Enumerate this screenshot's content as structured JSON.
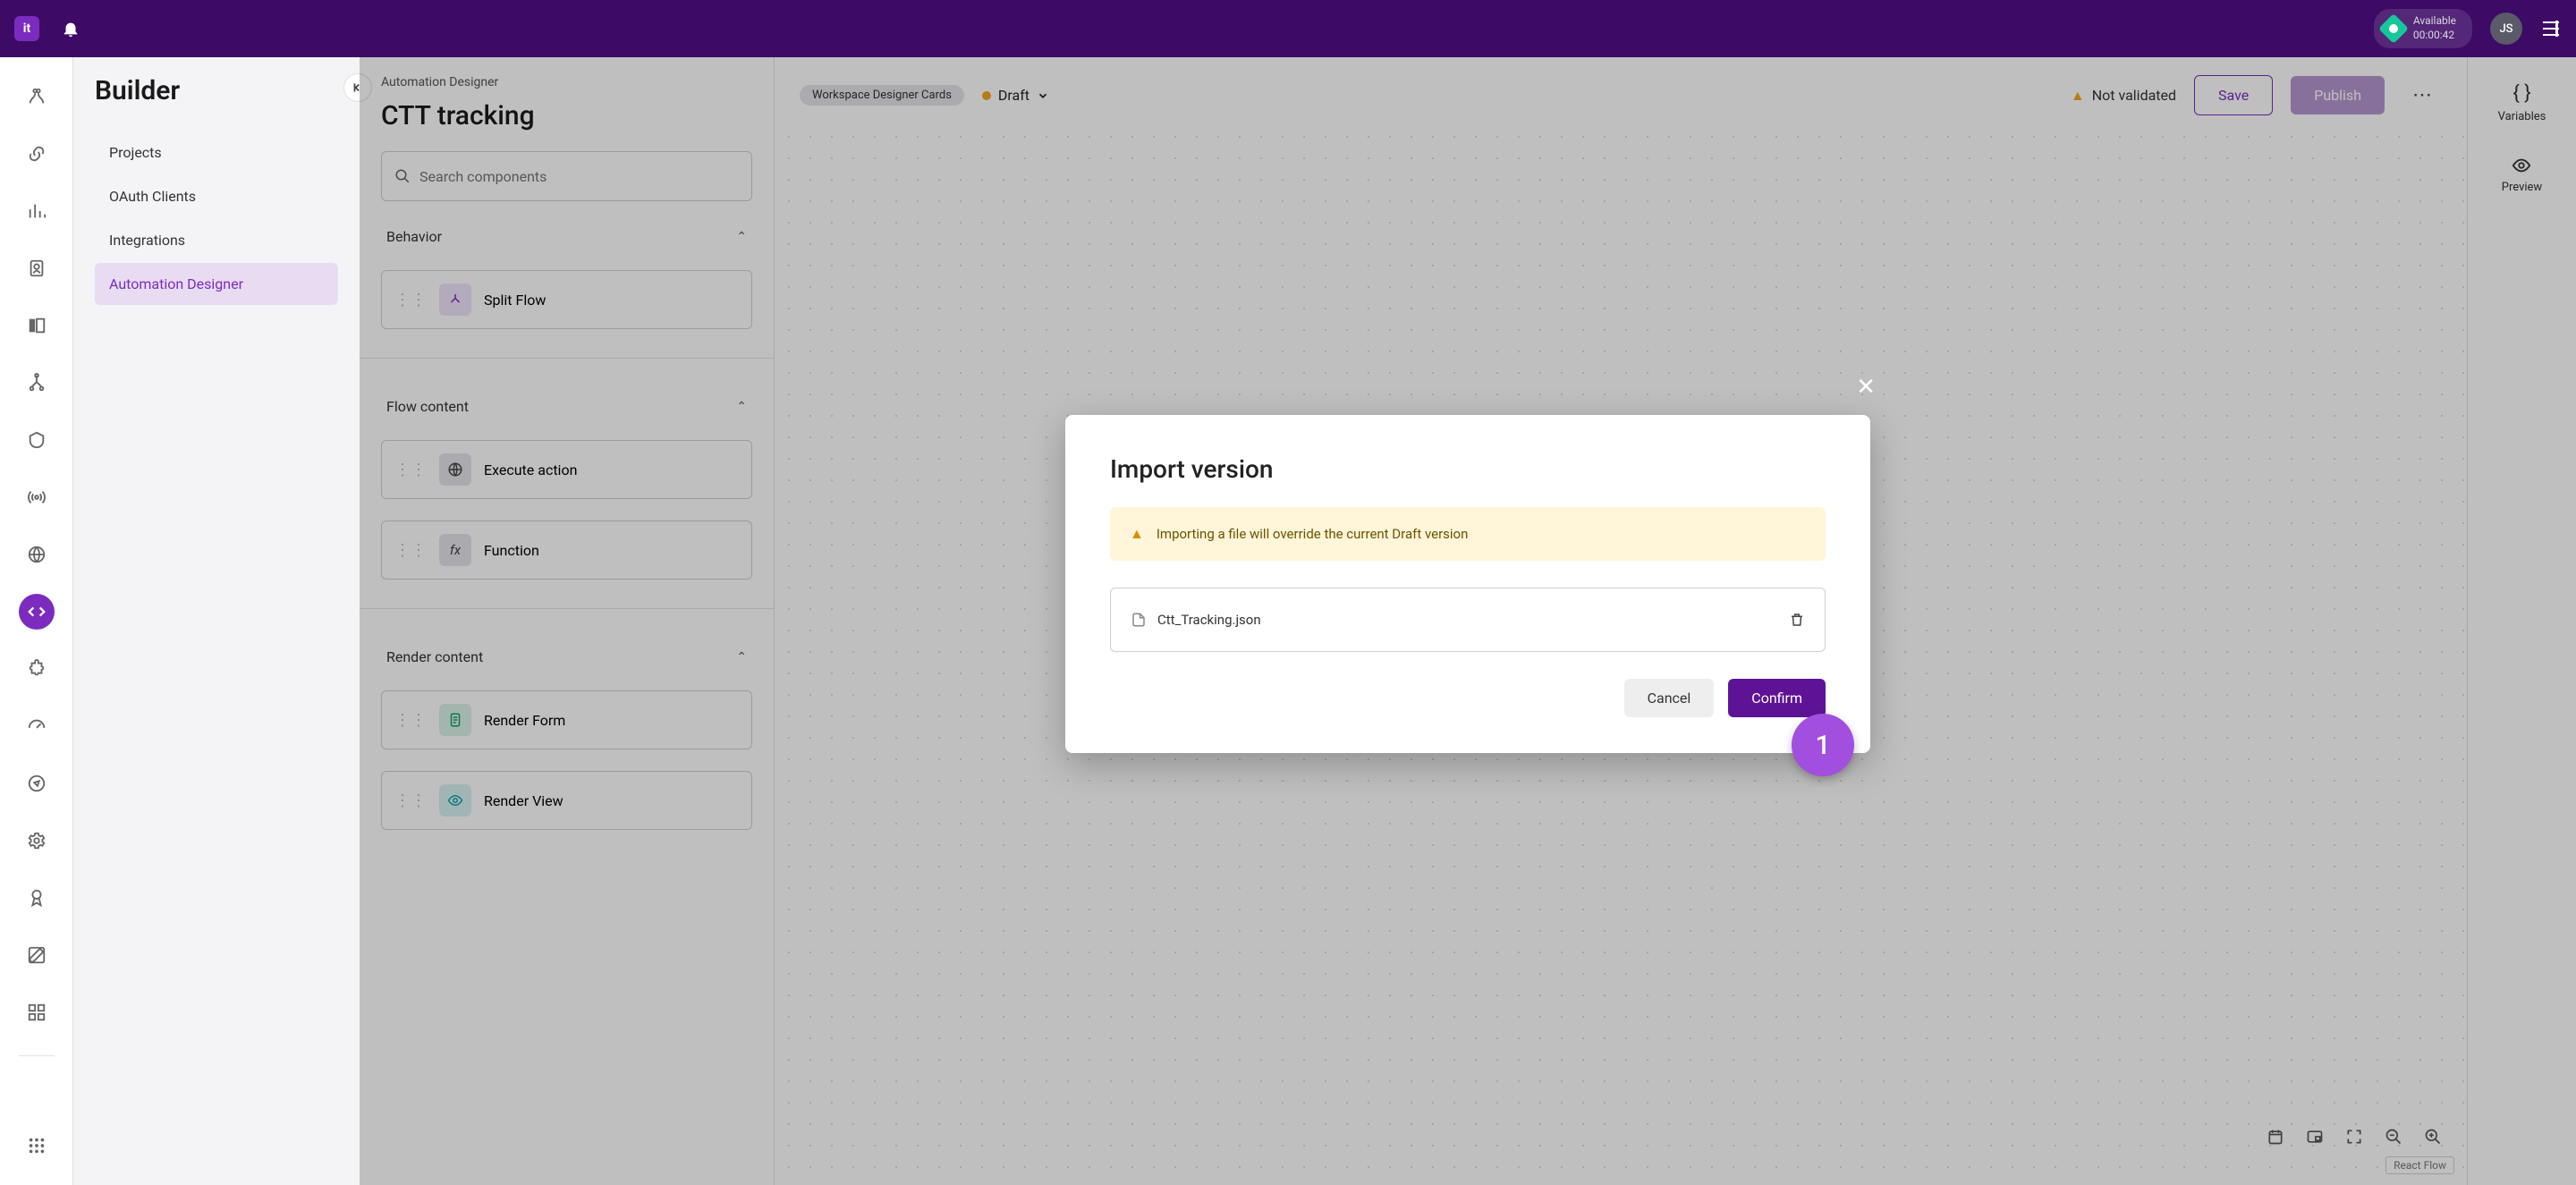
{
  "topbar": {
    "logo_letters": "it",
    "status_label": "Available",
    "status_timer": "00:00:42",
    "avatar_initials": "JS"
  },
  "builder": {
    "title": "Builder",
    "items": [
      "Projects",
      "OAuth Clients",
      "Integrations",
      "Automation Designer"
    ],
    "active_index": 3
  },
  "page": {
    "breadcrumb": "Automation Designer",
    "title": "CTT tracking",
    "chip": "Workspace Designer Cards",
    "state": "Draft",
    "validation_text": "Not validated",
    "save_label": "Save",
    "publish_label": "Publish",
    "search_placeholder": "Search components"
  },
  "sections": {
    "behavior": {
      "label": "Behavior",
      "items": [
        "Split Flow"
      ]
    },
    "flow": {
      "label": "Flow content",
      "items": [
        "Execute action",
        "Function"
      ]
    },
    "render": {
      "label": "Render content",
      "items": [
        "Render Form",
        "Render View"
      ]
    }
  },
  "right_rail": {
    "variables": "Variables",
    "preview": "Preview"
  },
  "canvas": {
    "reactflow": "React Flow"
  },
  "modal": {
    "title": "Import version",
    "alert": "Importing a file will override the current Draft version",
    "filename": "Ctt_Tracking.json",
    "cancel": "Cancel",
    "confirm": "Confirm",
    "step_badge": "1"
  }
}
